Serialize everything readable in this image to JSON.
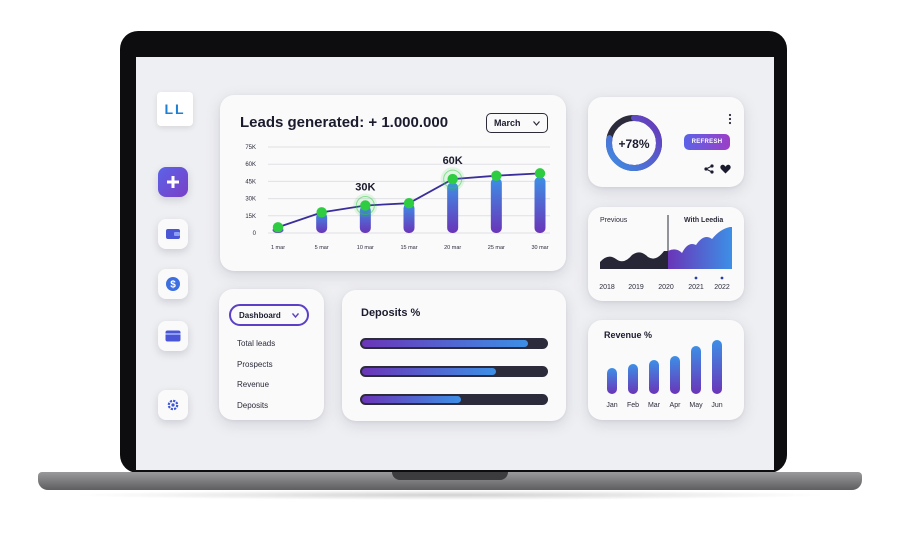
{
  "sidebar": {
    "logo_text": "LL",
    "items": [
      {
        "name": "plus-icon",
        "active": true
      },
      {
        "name": "wallet-icon",
        "active": false
      },
      {
        "name": "dollar-icon",
        "active": false
      },
      {
        "name": "credit-card-icon",
        "active": false
      },
      {
        "name": "gear-icon",
        "active": false
      }
    ]
  },
  "leads": {
    "title": "Leads generated:",
    "total": "+ 1.000.000",
    "month_selected": "March"
  },
  "donut": {
    "value_label": "+78%",
    "value": 78,
    "refresh_label": "REFRESH",
    "menu_icon": "more-vertical-icon",
    "share_icon": "share-icon",
    "like_icon": "heart-icon"
  },
  "comparison": {
    "previous_label": "Previous",
    "leedia_label": "With Leedia"
  },
  "menu": {
    "selected": "Dashboard",
    "items": [
      "Total leads",
      "Prospects",
      "Revenue",
      "Deposits"
    ]
  },
  "deposits": {
    "title": "Deposits %",
    "values": [
      0.9,
      0.73,
      0.54
    ]
  },
  "revenue": {
    "title": "Revenue %"
  },
  "colors": {
    "accent_purple": "#6a35b8",
    "accent_blue": "#3d8fe6",
    "marker_green": "#2ecc40",
    "dark_text": "#1b1b2e"
  },
  "chart_data": [
    {
      "type": "bar",
      "title": "",
      "categories": [
        "1 mar",
        "5 mar",
        "10 mar",
        "15 mar",
        "20 mar",
        "25 mar",
        "30 mar"
      ],
      "values": [
        5,
        18,
        24,
        26,
        44,
        48,
        49
      ],
      "line_values": [
        5,
        18,
        24,
        26,
        47,
        50,
        52
      ],
      "annotations": [
        {
          "category": "10 mar",
          "label": "30K"
        },
        {
          "category": "20 mar",
          "label": "60K"
        }
      ],
      "yticks": [
        "0",
        "15K",
        "30K",
        "45K",
        "60K",
        "75K"
      ],
      "ylim": [
        0,
        75
      ],
      "grid": true
    },
    {
      "type": "area",
      "title": "",
      "x": [
        "2018",
        "2019",
        "2020",
        "2021",
        "2022"
      ],
      "highlight_x": [
        "2021",
        "2022"
      ]
    },
    {
      "type": "bar",
      "title": "Revenue %",
      "categories": [
        "Jan",
        "Feb",
        "Mar",
        "Apr",
        "May",
        "Jun"
      ],
      "values": [
        26,
        30,
        34,
        38,
        48,
        54
      ],
      "ylim": [
        0,
        60
      ]
    }
  ]
}
